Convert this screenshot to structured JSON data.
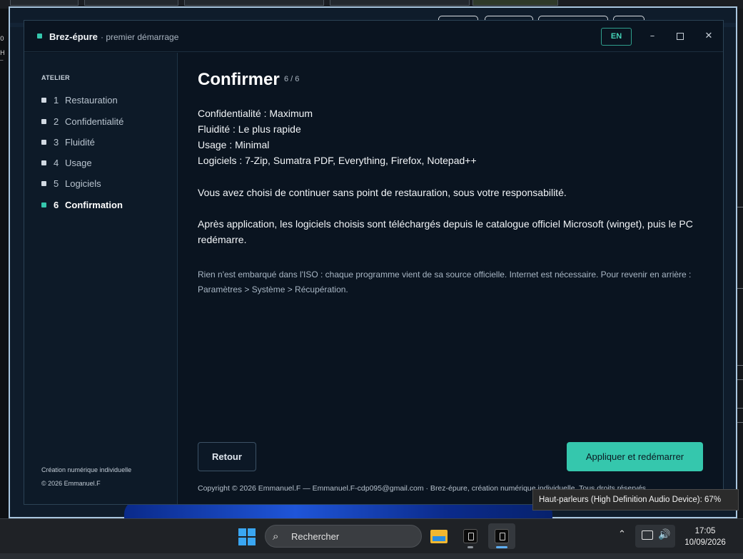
{
  "app": {
    "name": "Brez-épure",
    "subtitle": "· premier démarrage",
    "lang_button": "EN",
    "controls": {
      "minimize": "–",
      "close": "✕"
    }
  },
  "sidebar": {
    "title": "ATELIER",
    "steps": [
      {
        "num": "1",
        "label": "Restauration"
      },
      {
        "num": "2",
        "label": "Confidentialité"
      },
      {
        "num": "3",
        "label": "Fluidité"
      },
      {
        "num": "4",
        "label": "Usage"
      },
      {
        "num": "5",
        "label": "Logiciels"
      },
      {
        "num": "6",
        "label": "Confirmation",
        "active": true
      }
    ],
    "footer_line1": "Création numérique individuelle",
    "footer_line2": "© 2026 Emmanuel.F"
  },
  "main": {
    "title": "Confirmer",
    "step_count": "6 / 6",
    "summary": [
      "Confidentialité : Maximum",
      "Fluidité : Le plus rapide",
      "Usage : Minimal",
      "Logiciels : 7-Zip, Sumatra PDF, Everything, Firefox, Notepad++"
    ],
    "restore_warning": "Vous avez choisi de continuer sans point de restauration, sous votre responsabilité.",
    "after_apply": "Après application, les logiciels choisis sont téléchargés depuis le catalogue officiel Microsoft (winget), puis le PC redémarre.",
    "note": "Rien n'est embarqué dans l'ISO : chaque programme vient de sa source officielle. Internet est nécessaire. Pour revenir en arrière : Paramètres > Système > Récupération.",
    "back_button": "Retour",
    "apply_button": "Appliquer et redémarrer",
    "copyright": "Copyright © 2026 Emmanuel.F — Emmanuel.F-cdp095@gmail.com · Brez-épure, création numérique individuelle. Tous droits réservés."
  },
  "tooltip": "Haut-parleurs (High Definition Audio Device): 67%",
  "volume_percent": 67,
  "taskbar": {
    "search_placeholder": "Rechercher",
    "time": "17:05",
    "date": "10/09/2026"
  },
  "colors": {
    "accent": "#35c7ad",
    "window_bg": "#0a1420",
    "sidebar_bg": "#0d1a28",
    "text": "#f2f5f8"
  }
}
